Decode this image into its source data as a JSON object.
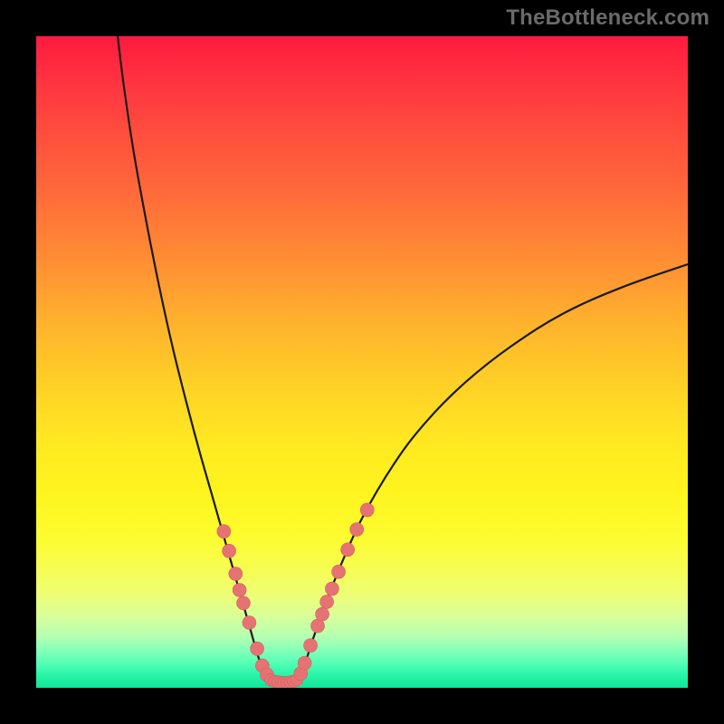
{
  "watermark": "TheBottleneck.com",
  "colors": {
    "background": "#000000",
    "curve_stroke": "#1a1a1a",
    "marker_fill": "#e57373",
    "marker_stroke": "#d45f5f"
  },
  "chart_data": {
    "type": "line",
    "title": "",
    "xlabel": "",
    "ylabel": "",
    "xlim": [
      0,
      100
    ],
    "ylim": [
      0,
      100
    ],
    "curve_left": {
      "name": "left-branch",
      "x": [
        12.5,
        13.5,
        15,
        17,
        19,
        21,
        23,
        25,
        27,
        29,
        30,
        31,
        32,
        33,
        34,
        35,
        36
      ],
      "y": [
        100,
        92,
        82,
        71,
        61,
        52,
        44,
        36.5,
        29.5,
        22.5,
        19,
        15.5,
        12,
        8.5,
        5,
        2.5,
        1
      ]
    },
    "curve_right": {
      "name": "right-branch",
      "x": [
        40,
        41,
        43,
        46,
        50,
        55,
        60,
        66,
        73,
        81,
        90,
        100
      ],
      "y": [
        1,
        3,
        9,
        17,
        26,
        34.5,
        41,
        47,
        52.5,
        57.5,
        61.5,
        65
      ]
    },
    "valley_floor": {
      "name": "valley",
      "x": [
        36,
        37,
        38,
        39,
        40
      ],
      "y": [
        1,
        0.6,
        0.5,
        0.6,
        1
      ]
    },
    "markers_left": {
      "name": "left-dots",
      "points": [
        {
          "x": 28.8,
          "y": 24
        },
        {
          "x": 29.6,
          "y": 21
        },
        {
          "x": 30.6,
          "y": 17.5
        },
        {
          "x": 31.2,
          "y": 15
        },
        {
          "x": 31.8,
          "y": 13
        },
        {
          "x": 32.7,
          "y": 10
        },
        {
          "x": 33.9,
          "y": 6
        },
        {
          "x": 34.7,
          "y": 3.4
        },
        {
          "x": 35.4,
          "y": 2
        }
      ]
    },
    "markers_valley": {
      "name": "valley-dots",
      "points": [
        {
          "x": 36.0,
          "y": 1.2
        },
        {
          "x": 36.6,
          "y": 1.0
        },
        {
          "x": 37.1,
          "y": 0.9
        },
        {
          "x": 37.6,
          "y": 0.8
        },
        {
          "x": 38.0,
          "y": 0.8
        },
        {
          "x": 38.5,
          "y": 0.8
        },
        {
          "x": 39.0,
          "y": 0.9
        },
        {
          "x": 39.5,
          "y": 1.0
        },
        {
          "x": 40.0,
          "y": 1.2
        }
      ]
    },
    "markers_right": {
      "name": "right-dots",
      "points": [
        {
          "x": 40.6,
          "y": 2.2
        },
        {
          "x": 41.2,
          "y": 3.8
        },
        {
          "x": 42.1,
          "y": 6.5
        },
        {
          "x": 43.2,
          "y": 9.5
        },
        {
          "x": 43.9,
          "y": 11.3
        },
        {
          "x": 44.6,
          "y": 13.2
        },
        {
          "x": 45.4,
          "y": 15.2
        },
        {
          "x": 46.4,
          "y": 17.8
        },
        {
          "x": 47.8,
          "y": 21.2
        },
        {
          "x": 49.2,
          "y": 24.3
        },
        {
          "x": 50.8,
          "y": 27.3
        }
      ]
    }
  }
}
